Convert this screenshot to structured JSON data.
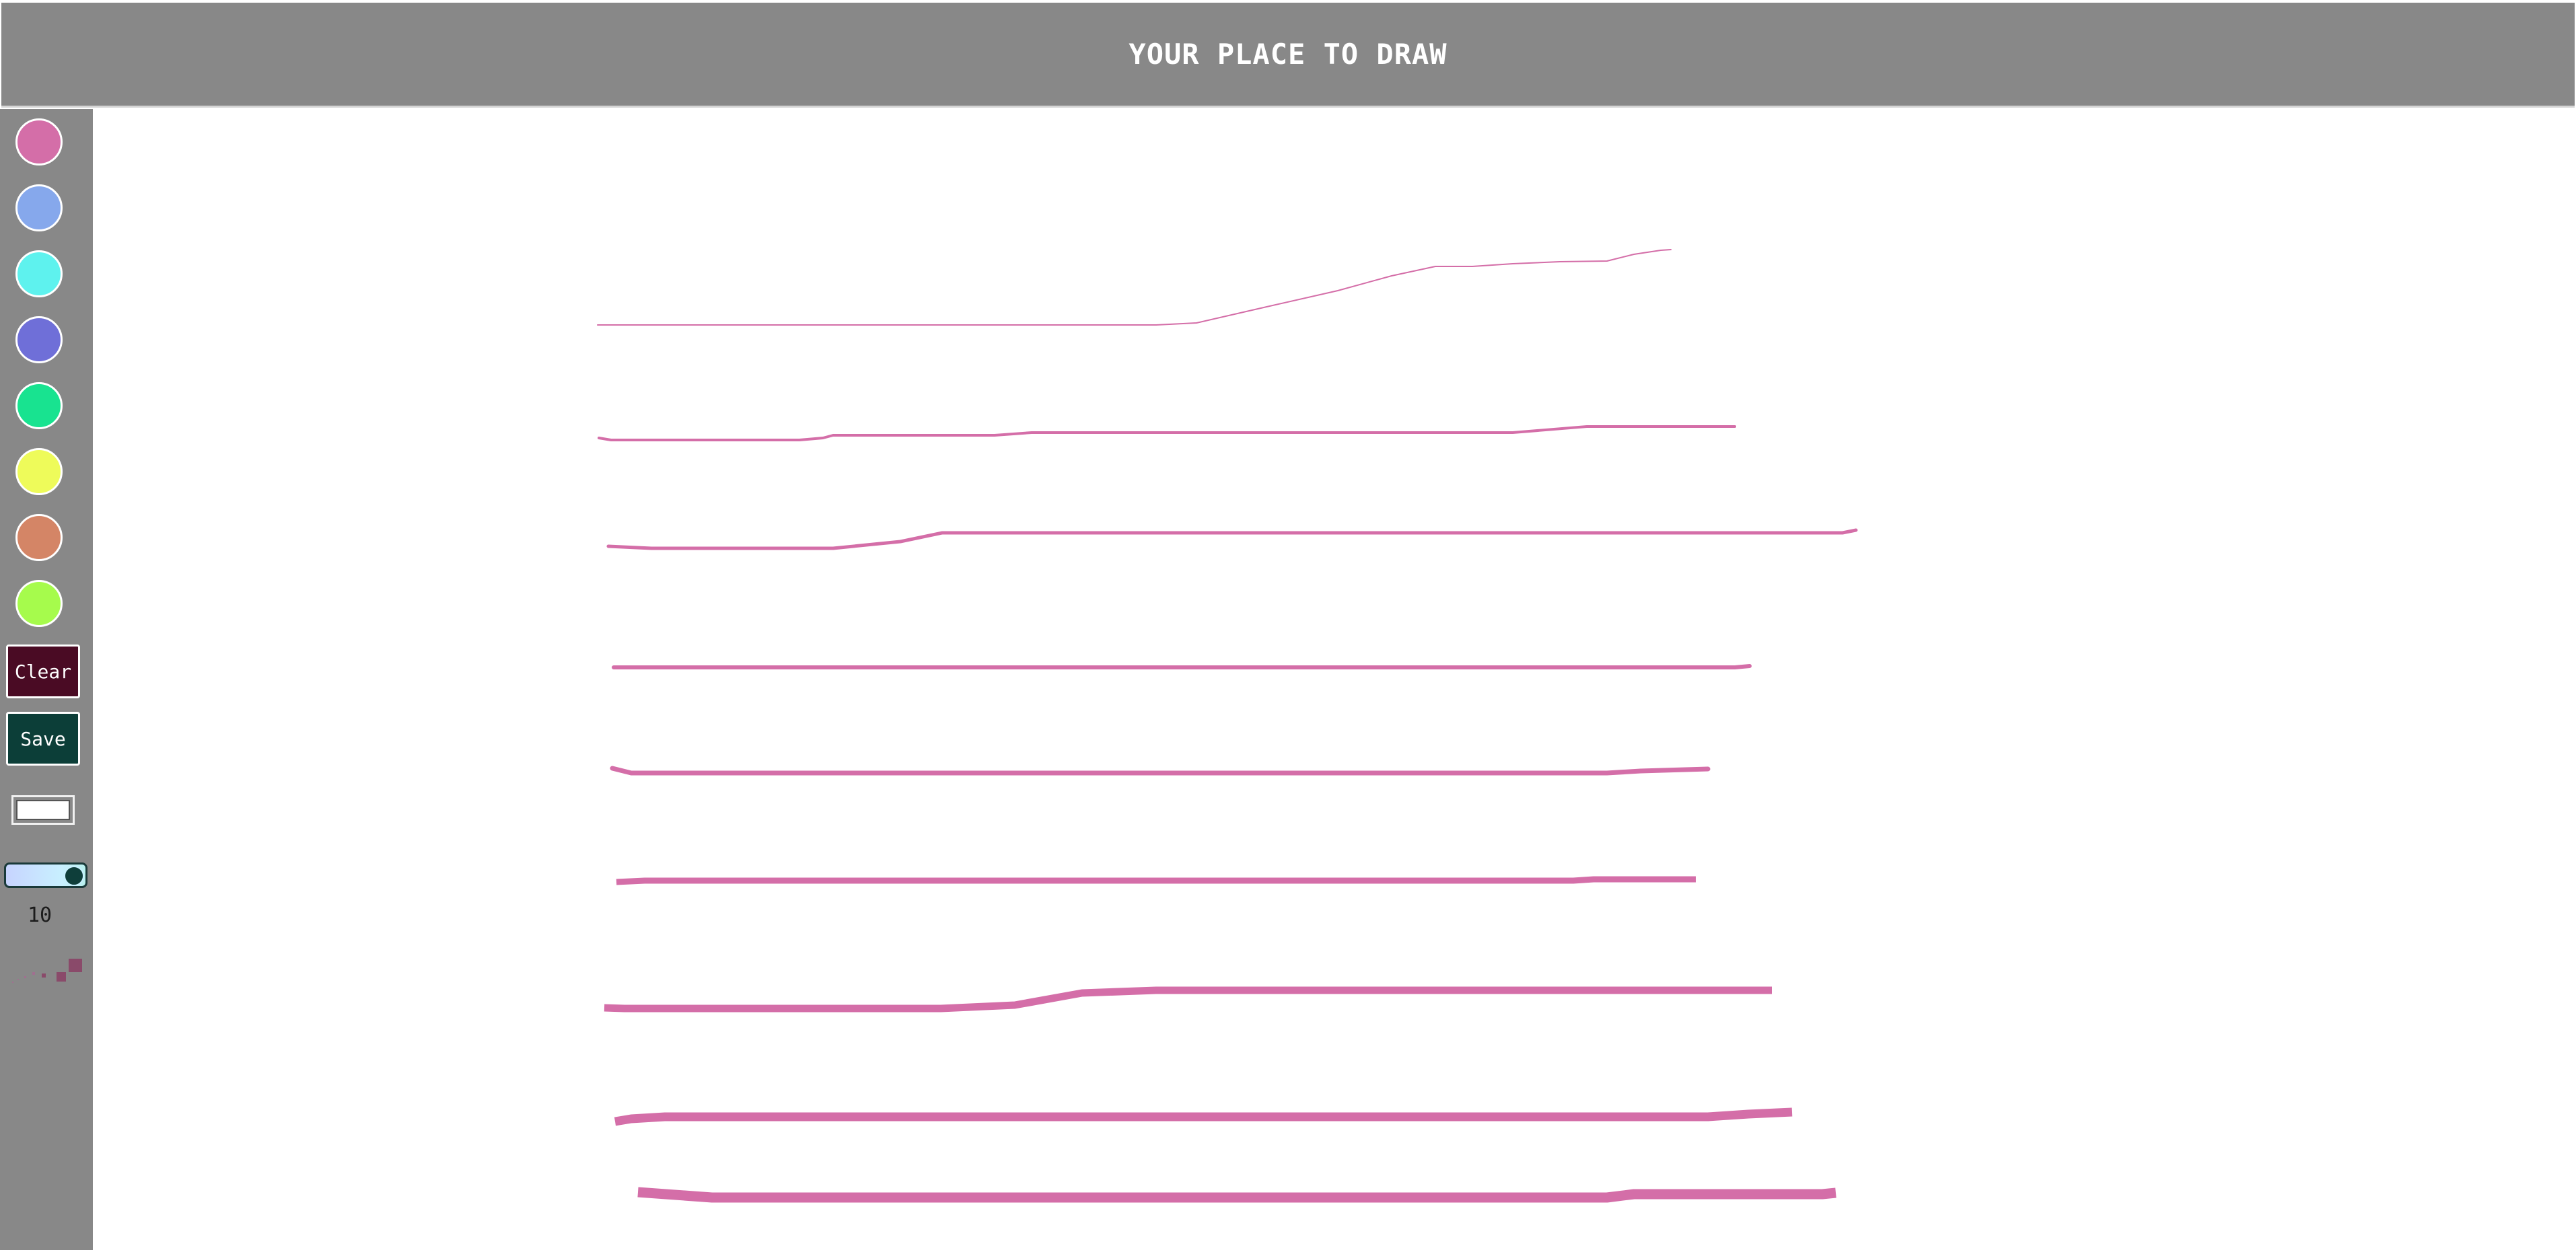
{
  "header": {
    "title": "YOUR PLACE TO DRAW"
  },
  "toolbar": {
    "swatches": [
      {
        "name": "pink",
        "color": "#d46ea8"
      },
      {
        "name": "light-blue",
        "color": "#86a8ec"
      },
      {
        "name": "cyan",
        "color": "#5ef2ee"
      },
      {
        "name": "indigo",
        "color": "#6f6fd8"
      },
      {
        "name": "green",
        "color": "#18e390"
      },
      {
        "name": "yellow",
        "color": "#eefb5a"
      },
      {
        "name": "salmon",
        "color": "#d48566"
      },
      {
        "name": "lime",
        "color": "#a6fb4c"
      }
    ],
    "clear_label": "Clear",
    "clear_color": "#4a0b24",
    "save_label": "Save",
    "save_color": "#0c3e38",
    "custom_color_value": "#ffffff",
    "brush_size": "10"
  },
  "canvas": {
    "stroke_color": "#d46ea8",
    "background": "#ffffff"
  }
}
